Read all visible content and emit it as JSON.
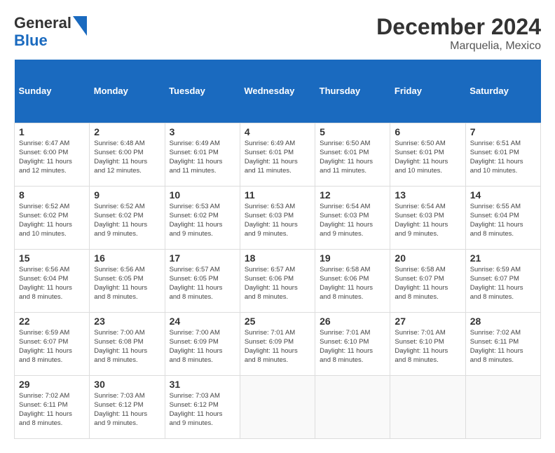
{
  "header": {
    "logo_line1": "General",
    "logo_line2": "Blue",
    "title": "December 2024",
    "subtitle": "Marquelia, Mexico"
  },
  "weekdays": [
    "Sunday",
    "Monday",
    "Tuesday",
    "Wednesday",
    "Thursday",
    "Friday",
    "Saturday"
  ],
  "weeks": [
    [
      {
        "day": "1",
        "sunrise": "Sunrise: 6:47 AM",
        "sunset": "Sunset: 6:00 PM",
        "daylight": "Daylight: 11 hours and 12 minutes."
      },
      {
        "day": "2",
        "sunrise": "Sunrise: 6:48 AM",
        "sunset": "Sunset: 6:00 PM",
        "daylight": "Daylight: 11 hours and 12 minutes."
      },
      {
        "day": "3",
        "sunrise": "Sunrise: 6:49 AM",
        "sunset": "Sunset: 6:01 PM",
        "daylight": "Daylight: 11 hours and 11 minutes."
      },
      {
        "day": "4",
        "sunrise": "Sunrise: 6:49 AM",
        "sunset": "Sunset: 6:01 PM",
        "daylight": "Daylight: 11 hours and 11 minutes."
      },
      {
        "day": "5",
        "sunrise": "Sunrise: 6:50 AM",
        "sunset": "Sunset: 6:01 PM",
        "daylight": "Daylight: 11 hours and 11 minutes."
      },
      {
        "day": "6",
        "sunrise": "Sunrise: 6:50 AM",
        "sunset": "Sunset: 6:01 PM",
        "daylight": "Daylight: 11 hours and 10 minutes."
      },
      {
        "day": "7",
        "sunrise": "Sunrise: 6:51 AM",
        "sunset": "Sunset: 6:01 PM",
        "daylight": "Daylight: 11 hours and 10 minutes."
      }
    ],
    [
      {
        "day": "8",
        "sunrise": "Sunrise: 6:52 AM",
        "sunset": "Sunset: 6:02 PM",
        "daylight": "Daylight: 11 hours and 10 minutes."
      },
      {
        "day": "9",
        "sunrise": "Sunrise: 6:52 AM",
        "sunset": "Sunset: 6:02 PM",
        "daylight": "Daylight: 11 hours and 9 minutes."
      },
      {
        "day": "10",
        "sunrise": "Sunrise: 6:53 AM",
        "sunset": "Sunset: 6:02 PM",
        "daylight": "Daylight: 11 hours and 9 minutes."
      },
      {
        "day": "11",
        "sunrise": "Sunrise: 6:53 AM",
        "sunset": "Sunset: 6:03 PM",
        "daylight": "Daylight: 11 hours and 9 minutes."
      },
      {
        "day": "12",
        "sunrise": "Sunrise: 6:54 AM",
        "sunset": "Sunset: 6:03 PM",
        "daylight": "Daylight: 11 hours and 9 minutes."
      },
      {
        "day": "13",
        "sunrise": "Sunrise: 6:54 AM",
        "sunset": "Sunset: 6:03 PM",
        "daylight": "Daylight: 11 hours and 9 minutes."
      },
      {
        "day": "14",
        "sunrise": "Sunrise: 6:55 AM",
        "sunset": "Sunset: 6:04 PM",
        "daylight": "Daylight: 11 hours and 8 minutes."
      }
    ],
    [
      {
        "day": "15",
        "sunrise": "Sunrise: 6:56 AM",
        "sunset": "Sunset: 6:04 PM",
        "daylight": "Daylight: 11 hours and 8 minutes."
      },
      {
        "day": "16",
        "sunrise": "Sunrise: 6:56 AM",
        "sunset": "Sunset: 6:05 PM",
        "daylight": "Daylight: 11 hours and 8 minutes."
      },
      {
        "day": "17",
        "sunrise": "Sunrise: 6:57 AM",
        "sunset": "Sunset: 6:05 PM",
        "daylight": "Daylight: 11 hours and 8 minutes."
      },
      {
        "day": "18",
        "sunrise": "Sunrise: 6:57 AM",
        "sunset": "Sunset: 6:06 PM",
        "daylight": "Daylight: 11 hours and 8 minutes."
      },
      {
        "day": "19",
        "sunrise": "Sunrise: 6:58 AM",
        "sunset": "Sunset: 6:06 PM",
        "daylight": "Daylight: 11 hours and 8 minutes."
      },
      {
        "day": "20",
        "sunrise": "Sunrise: 6:58 AM",
        "sunset": "Sunset: 6:07 PM",
        "daylight": "Daylight: 11 hours and 8 minutes."
      },
      {
        "day": "21",
        "sunrise": "Sunrise: 6:59 AM",
        "sunset": "Sunset: 6:07 PM",
        "daylight": "Daylight: 11 hours and 8 minutes."
      }
    ],
    [
      {
        "day": "22",
        "sunrise": "Sunrise: 6:59 AM",
        "sunset": "Sunset: 6:07 PM",
        "daylight": "Daylight: 11 hours and 8 minutes."
      },
      {
        "day": "23",
        "sunrise": "Sunrise: 7:00 AM",
        "sunset": "Sunset: 6:08 PM",
        "daylight": "Daylight: 11 hours and 8 minutes."
      },
      {
        "day": "24",
        "sunrise": "Sunrise: 7:00 AM",
        "sunset": "Sunset: 6:09 PM",
        "daylight": "Daylight: 11 hours and 8 minutes."
      },
      {
        "day": "25",
        "sunrise": "Sunrise: 7:01 AM",
        "sunset": "Sunset: 6:09 PM",
        "daylight": "Daylight: 11 hours and 8 minutes."
      },
      {
        "day": "26",
        "sunrise": "Sunrise: 7:01 AM",
        "sunset": "Sunset: 6:10 PM",
        "daylight": "Daylight: 11 hours and 8 minutes."
      },
      {
        "day": "27",
        "sunrise": "Sunrise: 7:01 AM",
        "sunset": "Sunset: 6:10 PM",
        "daylight": "Daylight: 11 hours and 8 minutes."
      },
      {
        "day": "28",
        "sunrise": "Sunrise: 7:02 AM",
        "sunset": "Sunset: 6:11 PM",
        "daylight": "Daylight: 11 hours and 8 minutes."
      }
    ],
    [
      {
        "day": "29",
        "sunrise": "Sunrise: 7:02 AM",
        "sunset": "Sunset: 6:11 PM",
        "daylight": "Daylight: 11 hours and 8 minutes."
      },
      {
        "day": "30",
        "sunrise": "Sunrise: 7:03 AM",
        "sunset": "Sunset: 6:12 PM",
        "daylight": "Daylight: 11 hours and 9 minutes."
      },
      {
        "day": "31",
        "sunrise": "Sunrise: 7:03 AM",
        "sunset": "Sunset: 6:12 PM",
        "daylight": "Daylight: 11 hours and 9 minutes."
      },
      null,
      null,
      null,
      null
    ]
  ]
}
